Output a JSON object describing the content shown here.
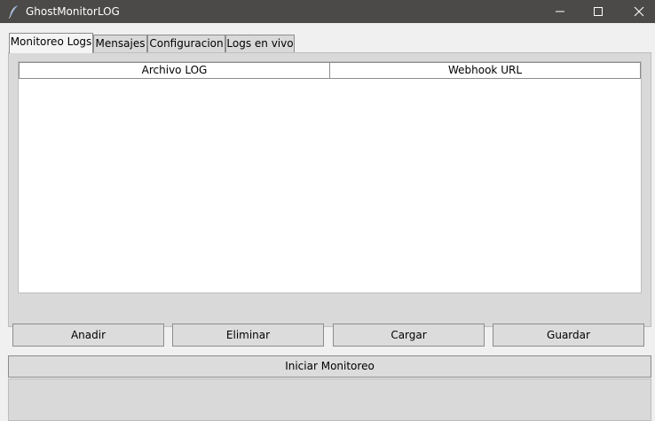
{
  "window": {
    "title": "GhostMonitorLOG",
    "icon": "feather-icon",
    "controls": [
      "minimize-icon",
      "maximize-icon",
      "close-icon"
    ]
  },
  "tabs": [
    {
      "label": "Monitoreo Logs",
      "active": true
    },
    {
      "label": "Mensajes",
      "active": false
    },
    {
      "label": "Configuracion",
      "active": false
    },
    {
      "label": "Logs en vivo",
      "active": false
    }
  ],
  "table": {
    "columns": [
      "Archivo LOG",
      "Webhook URL"
    ],
    "rows": []
  },
  "actions": {
    "add_label": "Anadir",
    "delete_label": "Eliminar",
    "load_label": "Cargar",
    "save_label": "Guardar"
  },
  "start_monitor_label": "Iniciar Monitoreo",
  "status_text": "",
  "colors": {
    "titlebar": "#4c4a48",
    "panel": "#d9d9d9",
    "button": "#dcdcdc",
    "list_background": "#ffffff"
  }
}
